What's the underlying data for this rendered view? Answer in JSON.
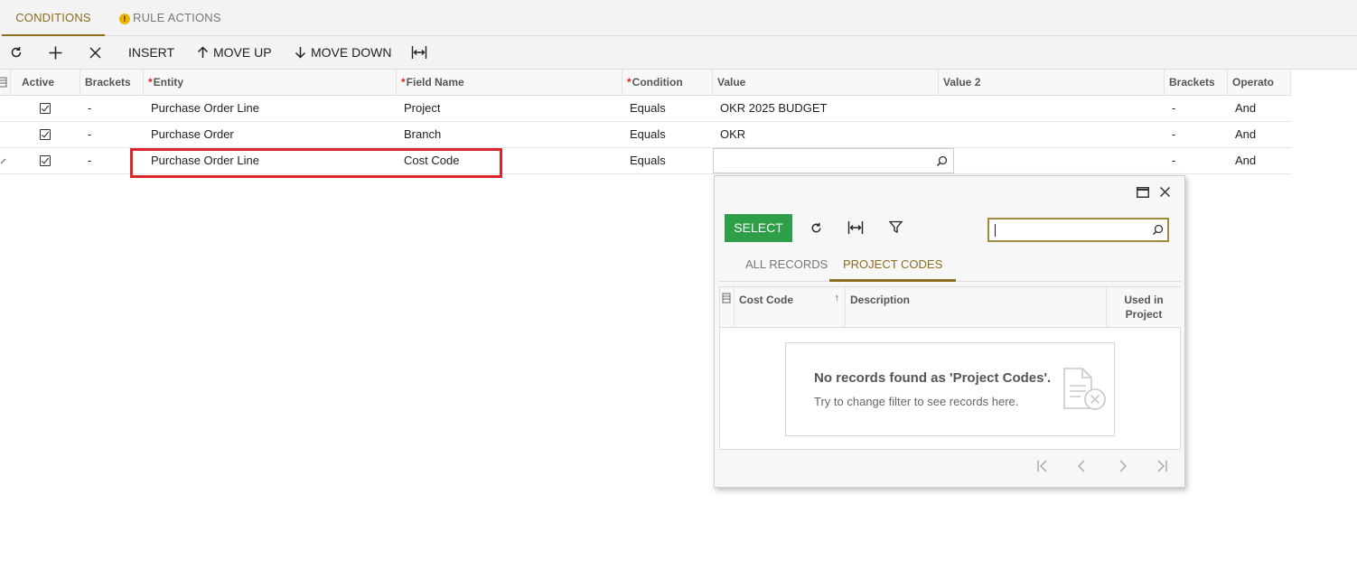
{
  "tabs": [
    {
      "label": "CONDITIONS",
      "active": true
    },
    {
      "label": "RULE ACTIONS",
      "active": false,
      "warning": true
    }
  ],
  "toolbar": {
    "insert_label": "INSERT",
    "move_up_label": "MOVE UP",
    "move_down_label": "MOVE DOWN"
  },
  "grid": {
    "columns": {
      "active": "Active",
      "brackets_open": "Brackets",
      "entity": "Entity",
      "field_name": "Field Name",
      "condition": "Condition",
      "value": "Value",
      "value2": "Value 2",
      "brackets_close": "Brackets",
      "operator": "Operato"
    },
    "rows": [
      {
        "active": true,
        "brackets_open": "-",
        "entity": "Purchase Order Line",
        "field_name": "Project",
        "condition": "Equals",
        "value": "OKR 2025 BUDGET",
        "value2": "",
        "brackets_close": "-",
        "operator": "And"
      },
      {
        "active": true,
        "brackets_open": "-",
        "entity": "Purchase Order",
        "field_name": "Branch",
        "condition": "Equals",
        "value": "OKR",
        "value2": "",
        "brackets_close": "-",
        "operator": "And"
      },
      {
        "active": true,
        "brackets_open": "-",
        "entity": "Purchase Order Line",
        "field_name": "Cost Code",
        "condition": "Equals",
        "value": "",
        "value2": "",
        "brackets_close": "-",
        "operator": "And"
      }
    ]
  },
  "popup": {
    "select_label": "SELECT",
    "search_value": "",
    "tabs": [
      {
        "label": "ALL RECORDS",
        "active": false
      },
      {
        "label": "PROJECT CODES",
        "active": true
      }
    ],
    "columns": {
      "cost_code": "Cost Code",
      "description": "Description",
      "used_in_project": "Used in Project"
    },
    "empty_title": "No records found as 'Project Codes'.",
    "empty_subtitle": "Try to change filter to see records here."
  },
  "colors": {
    "accent": "#8a6d1f",
    "select_button": "#2e9e48",
    "highlight_border": "#d9262c",
    "warning": "#f0b400"
  }
}
